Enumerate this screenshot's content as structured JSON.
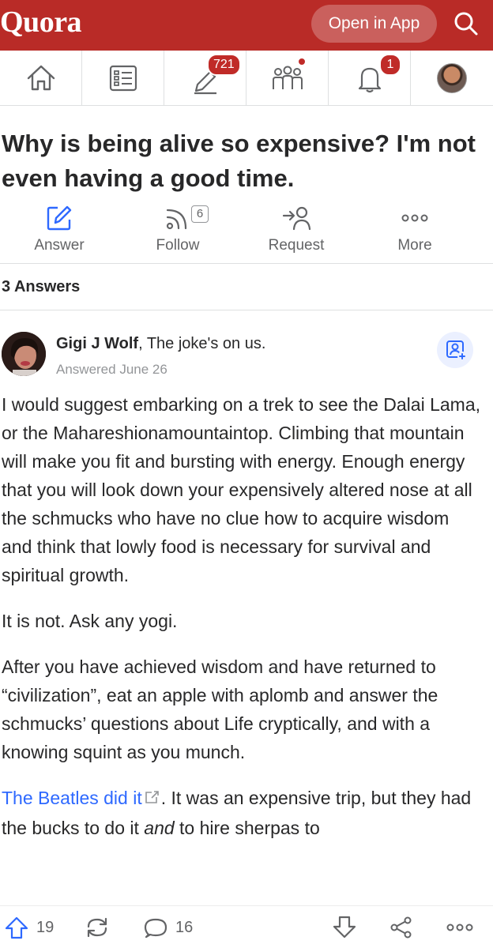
{
  "header": {
    "logo": "Quora",
    "open_in_app": "Open in App",
    "search_icon": "search-icon"
  },
  "nav": {
    "home_icon": "home-icon",
    "following_icon": "list-icon",
    "answer_badge": "721",
    "spaces_icon": "spaces-icon",
    "notifications_badge": "1"
  },
  "question": {
    "title": "Why is being alive so expensive? I'm not even having a good time."
  },
  "question_actions": {
    "answer": "Answer",
    "follow": "Follow",
    "follow_count": "6",
    "request": "Request",
    "more": "More"
  },
  "answers_count": "3 Answers",
  "answer": {
    "author_name": "Gigi J Wolf",
    "author_credential": ", The joke's on us.",
    "answered_date": "Answered June 26",
    "paragraphs": [
      "I would suggest embarking on a trek to see the Dalai Lama, or the Mahareshionamountaintop. Climbing that mountain will make you fit and bursting with energy. Enough energy that you will look down your expensively altered nose at all the schmucks who have no clue how to acquire wisdom and think that lowly food is necessary for survival and spiritual growth.",
      "It is not. Ask any yogi.",
      "After you have achieved wisdom and have returned to “civilization”, eat an apple with aplomb and answer the schmucks’ questions about Life cryptically, and with a knowing squint as you munch."
    ],
    "last_link": "The Beatles did it",
    "last_text_1": ". It was an expensive trip, but they had the bucks to do it ",
    "last_italic": "and",
    "last_text_2": " to hire sherpas to"
  },
  "bottom_bar": {
    "upvotes": "19",
    "comments": "16"
  },
  "colors": {
    "brand_red": "#b92b27",
    "badge_red": "#c02b28",
    "link_blue": "#2e69ff"
  }
}
